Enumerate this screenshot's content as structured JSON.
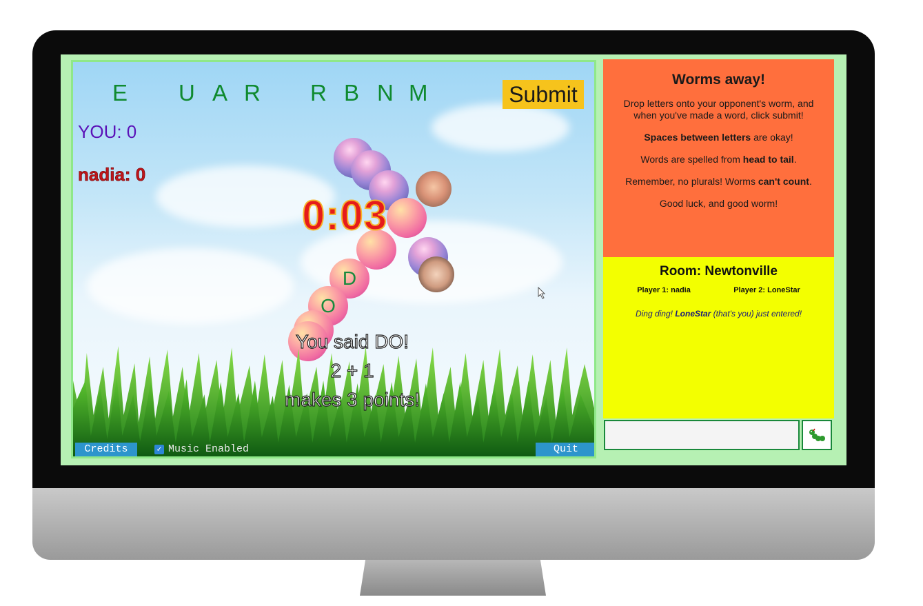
{
  "game": {
    "rack_letters": [
      "E",
      "U",
      "A",
      "R",
      "R",
      "B",
      "N",
      "M"
    ],
    "submit_label": "Submit",
    "score_you": "YOU: 0",
    "score_opponent": "nadia: 0",
    "timer": "0:03",
    "worm_letters": [
      "D",
      "O"
    ],
    "message_line1": "You said DO!",
    "message_line2": "2 + 1",
    "message_line3": "makes 3 points!",
    "credits_label": "Credits",
    "music_label": "Music Enabled",
    "music_enabled": true,
    "quit_label": "Quit"
  },
  "rules": {
    "title": "Worms away!",
    "line1": "Drop letters onto your opponent's worm, and when you've made a word, click submit!",
    "line2_bold": "Spaces between letters",
    "line2_rest": " are okay!",
    "line3_pre": "Words are spelled from ",
    "line3_bold": "head to tail",
    "line3_post": ".",
    "line4_pre": "Remember, no plurals! Worms ",
    "line4_bold": "can't count",
    "line4_post": ".",
    "line5": "Good luck, and good worm!"
  },
  "room": {
    "title": "Room: Newtonville",
    "player1": "Player 1: nadia",
    "player2": "Player 2: LoneStar",
    "notice_pre": "Ding ding! ",
    "notice_name": "LoneStar",
    "notice_post": " (that's you) just entered!"
  },
  "chat": {
    "input_value": "",
    "send_icon": "worm-icon"
  },
  "colors": {
    "rules_bg": "#ff6f3d",
    "room_bg": "#f3ff00",
    "button_blue": "#2d95cc",
    "submit_yellow": "#f6c31c",
    "rack_green": "#0f8a2f"
  }
}
